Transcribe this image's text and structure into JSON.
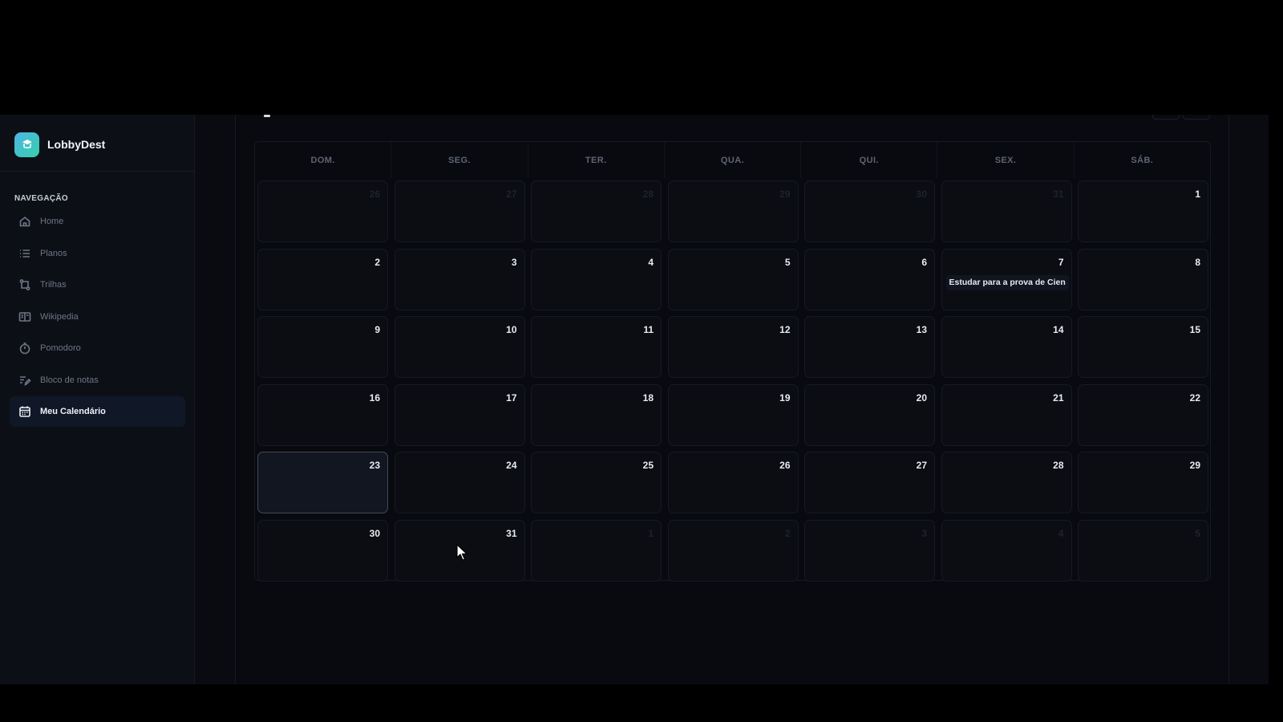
{
  "app": {
    "name": "LobbyDest"
  },
  "sidebar": {
    "section_title": "NAVEGAÇÃO",
    "items": [
      {
        "label": "Home",
        "icon": "home-icon"
      },
      {
        "label": "Planos",
        "icon": "list-icon"
      },
      {
        "label": "Trilhas",
        "icon": "trail-icon"
      },
      {
        "label": "Wikipedia",
        "icon": "book-icon"
      },
      {
        "label": "Pomodoro",
        "icon": "timer-icon"
      },
      {
        "label": "Bloco de notas",
        "icon": "notepad-icon"
      },
      {
        "label": "Meu Calendário",
        "icon": "calendar-icon",
        "active": true
      }
    ]
  },
  "calendar": {
    "weekdays": [
      "DOM.",
      "SEG.",
      "TER.",
      "QUA.",
      "QUI.",
      "SEX.",
      "SÁB."
    ],
    "weeks": [
      [
        {
          "n": "26",
          "muted": true
        },
        {
          "n": "27",
          "muted": true
        },
        {
          "n": "28",
          "muted": true
        },
        {
          "n": "29",
          "muted": true
        },
        {
          "n": "30",
          "muted": true
        },
        {
          "n": "31",
          "muted": true
        },
        {
          "n": "1"
        }
      ],
      [
        {
          "n": "2"
        },
        {
          "n": "3"
        },
        {
          "n": "4"
        },
        {
          "n": "5"
        },
        {
          "n": "6"
        },
        {
          "n": "7",
          "event": "Estudar para a prova de Cien"
        },
        {
          "n": "8"
        }
      ],
      [
        {
          "n": "9"
        },
        {
          "n": "10"
        },
        {
          "n": "11"
        },
        {
          "n": "12"
        },
        {
          "n": "13"
        },
        {
          "n": "14"
        },
        {
          "n": "15"
        }
      ],
      [
        {
          "n": "16"
        },
        {
          "n": "17"
        },
        {
          "n": "18"
        },
        {
          "n": "19"
        },
        {
          "n": "20"
        },
        {
          "n": "21"
        },
        {
          "n": "22"
        }
      ],
      [
        {
          "n": "23",
          "today": true
        },
        {
          "n": "24"
        },
        {
          "n": "25"
        },
        {
          "n": "26"
        },
        {
          "n": "27"
        },
        {
          "n": "28"
        },
        {
          "n": "29"
        }
      ],
      [
        {
          "n": "30"
        },
        {
          "n": "31"
        },
        {
          "n": "1",
          "muted": true
        },
        {
          "n": "2",
          "muted": true
        },
        {
          "n": "3",
          "muted": true
        },
        {
          "n": "4",
          "muted": true
        },
        {
          "n": "5",
          "muted": true
        }
      ]
    ]
  },
  "colors": {
    "accent": "#36d0a8",
    "active_bg": "#101827"
  }
}
